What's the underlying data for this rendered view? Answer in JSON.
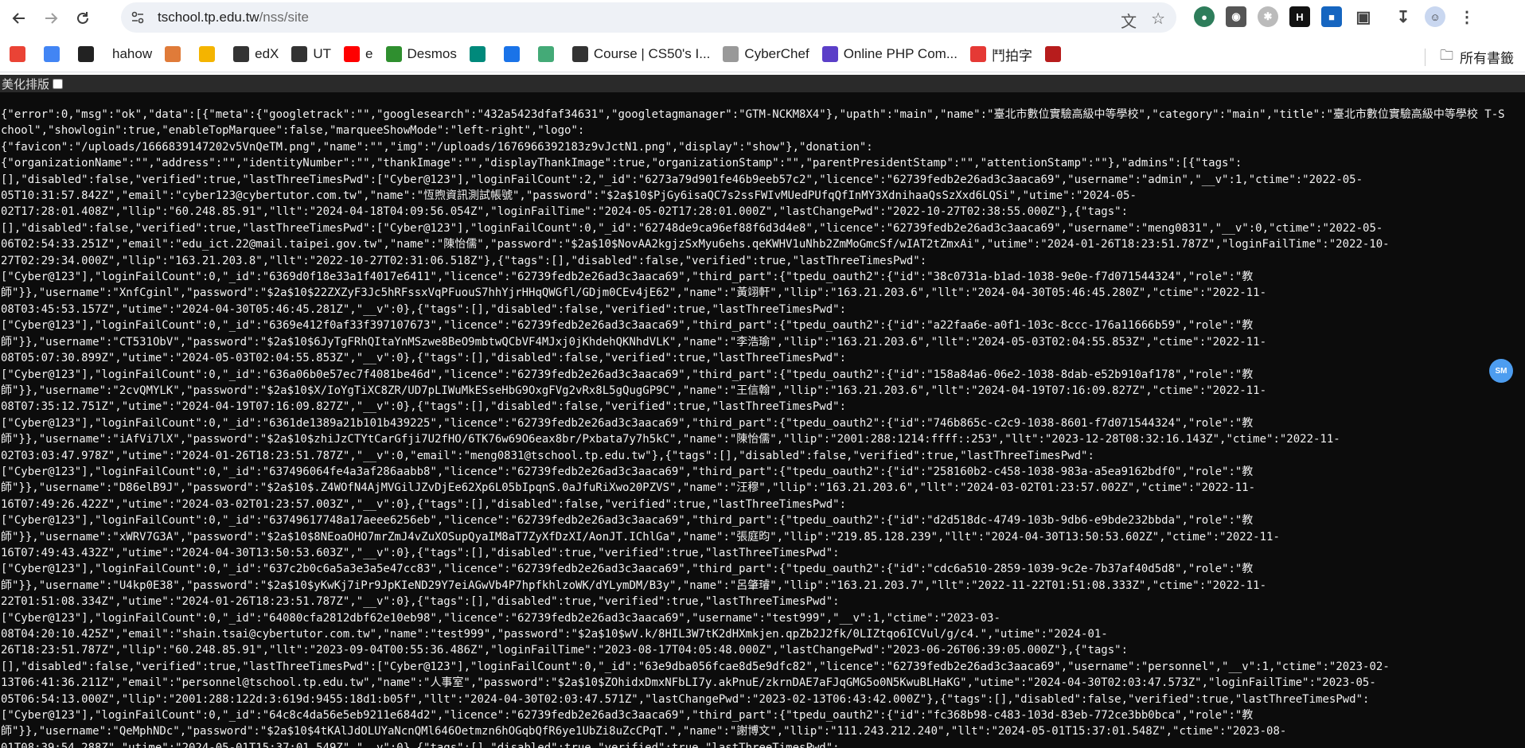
{
  "browser": {
    "url_host": "tschool.tp.edu.tw",
    "url_path": "/nss/site"
  },
  "bookmarks": [
    {
      "label": "",
      "icon": "gmail-icon",
      "color": "#ea4335"
    },
    {
      "label": "",
      "icon": "calendar-icon",
      "color": "#4285f4"
    },
    {
      "label": "",
      "icon": "infinity-icon",
      "color": "#222"
    },
    {
      "label": "hahow",
      "icon": "",
      "color": ""
    },
    {
      "label": "",
      "icon": "c-icon",
      "color": "#e07b39"
    },
    {
      "label": "",
      "icon": "photo-icon",
      "color": "#f4b400"
    },
    {
      "label": "edX",
      "icon": "edx-icon",
      "color": "#333"
    },
    {
      "label": "UT",
      "icon": "edx-icon",
      "color": "#333"
    },
    {
      "label": "e",
      "icon": "youtube-icon",
      "color": "#ff0000"
    },
    {
      "label": "Desmos",
      "icon": "desmos-icon",
      "color": "#2f8f2f"
    },
    {
      "label": "",
      "icon": "meet-icon",
      "color": "#00897b"
    },
    {
      "label": "",
      "icon": "drive-icon",
      "color": "#1a73e8"
    },
    {
      "label": "",
      "icon": "tree-icon",
      "color": "#4a7"
    },
    {
      "label": "Course | CS50's I...",
      "icon": "edx-icon",
      "color": "#333"
    },
    {
      "label": "CyberChef",
      "icon": "chef-icon",
      "color": "#999"
    },
    {
      "label": "Online PHP Com...",
      "icon": "php-icon",
      "color": "#5b3fc8"
    },
    {
      "label": "鬥拍字",
      "icon": "flame-icon",
      "color": "#e53935"
    },
    {
      "label": "",
      "icon": "red-square-icon",
      "color": "#b71c1c"
    }
  ],
  "all_bookmarks_label": "所有書籤",
  "pretty_print_label": "美化排版",
  "fab_label": "SM",
  "json_text": "{\"error\":0,\"msg\":\"ok\",\"data\":[{\"meta\":{\"googletrack\":\"\",\"googlesearch\":\"432a5423dfaf34631\",\"googletagmanager\":\"GTM-NCKM8X4\"},\"upath\":\"main\",\"name\":\"臺北市數位實驗高級中等學校\",\"category\":\"main\",\"title\":\"臺北市數位實驗高級中等學校 T-School\",\"showlogin\":true,\"enableTopMarquee\":false,\"marqueeShowMode\":\"left-right\",\"logo\":\n{\"favicon\":\"/uploads/1666839147202v5VnQeTM.png\",\"name\":\"\",\"img\":\"/uploads/1676966392183z9vJctN1.png\",\"display\":\"show\"},\"donation\":\n{\"organizationName\":\"\",\"address\":\"\",\"identityNumber\":\"\",\"thankImage\":\"\",\"displayThankImage\":true,\"organizationStamp\":\"\",\"parentPresidentStamp\":\"\",\"attentionStamp\":\"\"},\"admins\":[{\"tags\":\n[],\"disabled\":false,\"verified\":true,\"lastThreeTimesPwd\":[\"Cyber@123\"],\"loginFailCount\":2,\"_id\":\"6273a79d901fe46b9eeb57c2\",\"licence\":\"62739fedb2e26ad3c3aaca69\",\"username\":\"admin\",\"__v\":1,\"ctime\":\"2022-05-\n05T10:31:57.842Z\",\"email\":\"cyber123@cybertutor.com.tw\",\"name\":\"恆煦資訊測試帳號\",\"password\":\"$2a$10$PjGy6isaQC7s2ssFWIvMUedPUfqQfInMY3XdnihaaQsSzXxd6LQSi\",\"utime\":\"2024-05-\n02T17:28:01.408Z\",\"llip\":\"60.248.85.91\",\"llt\":\"2024-04-18T04:09:56.054Z\",\"loginFailTime\":\"2024-05-02T17:28:01.000Z\",\"lastChangePwd\":\"2022-10-27T02:38:55.000Z\"},{\"tags\":\n[],\"disabled\":false,\"verified\":true,\"lastThreeTimesPwd\":[\"Cyber@123\"],\"loginFailCount\":0,\"_id\":\"62748de9ca96ef88f6d3d4e8\",\"licence\":\"62739fedb2e26ad3c3aaca69\",\"username\":\"meng0831\",\"__v\":0,\"ctime\":\"2022-05-\n06T02:54:33.251Z\",\"email\":\"edu_ict.22@mail.taipei.gov.tw\",\"name\":\"陳怡儒\",\"password\":\"$2a$10$NovAA2kgjzSxMyu6ehs.qeKWHV1uNhb2ZmMoGmcSf/wIAT2tZmxAi\",\"utime\":\"2024-01-26T18:23:51.787Z\",\"loginFailTime\":\"2022-10-\n27T02:29:34.000Z\",\"llip\":\"163.21.203.8\",\"llt\":\"2022-10-27T02:31:06.518Z\"},{\"tags\":[],\"disabled\":false,\"verified\":true,\"lastThreeTimesPwd\":\n[\"Cyber@123\"],\"loginFailCount\":0,\"_id\":\"6369d0f18e33a1f4017e6411\",\"licence\":\"62739fedb2e26ad3c3aaca69\",\"third_part\":{\"tpedu_oauth2\":{\"id\":\"38c0731a-b1ad-1038-9e0e-f7d071544324\",\"role\":\"教\n師\"}},\"username\":\"XnfCginl\",\"password\":\"$2a$10$22ZXZyF3Jc5hRFssxVqPFuouS7hhYjrHHqQWGfl/GDjm0CEv4jE62\",\"name\":\"黃翊軒\",\"llip\":\"163.21.203.6\",\"llt\":\"2024-04-30T05:46:45.280Z\",\"ctime\":\"2022-11-\n08T03:45:53.157Z\",\"utime\":\"2024-04-30T05:46:45.281Z\",\"__v\":0},{\"tags\":[],\"disabled\":false,\"verified\":true,\"lastThreeTimesPwd\":\n[\"Cyber@123\"],\"loginFailCount\":0,\"_id\":\"6369e412f0af33f397107673\",\"licence\":\"62739fedb2e26ad3c3aaca69\",\"third_part\":{\"tpedu_oauth2\":{\"id\":\"a22faa6e-a0f1-103c-8ccc-176a11666b59\",\"role\":\"教\n師\"}},\"username\":\"CT531ObV\",\"password\":\"$2a$10$6JyTgFRhQItaYnMSzwe8BeO9mbtwQCbVF4MJxj0jKhdehQKNhdVLK\",\"name\":\"李浩瑜\",\"llip\":\"163.21.203.6\",\"llt\":\"2024-05-03T02:04:55.853Z\",\"ctime\":\"2022-11-\n08T05:07:30.899Z\",\"utime\":\"2024-05-03T02:04:55.853Z\",\"__v\":0},{\"tags\":[],\"disabled\":false,\"verified\":true,\"lastThreeTimesPwd\":\n[\"Cyber@123\"],\"loginFailCount\":0,\"_id\":\"636a06b0e57ec7f4081be46d\",\"licence\":\"62739fedb2e26ad3c3aaca69\",\"third_part\":{\"tpedu_oauth2\":{\"id\":\"158a84a6-06e2-1038-8dab-e52b910af178\",\"role\":\"教\n師\"}},\"username\":\"2cvQMYLK\",\"password\":\"$2a$10$X/IoYgTiXC8ZR/UD7pLIWuMkESseHbG9OxgFVg2vRx8L5gQugGP9C\",\"name\":\"王信翰\",\"llip\":\"163.21.203.6\",\"llt\":\"2024-04-19T07:16:09.827Z\",\"ctime\":\"2022-11-\n08T07:35:12.751Z\",\"utime\":\"2024-04-19T07:16:09.827Z\",\"__v\":0},{\"tags\":[],\"disabled\":false,\"verified\":true,\"lastThreeTimesPwd\":\n[\"Cyber@123\"],\"loginFailCount\":0,\"_id\":\"6361de1389a21b101b439225\",\"licence\":\"62739fedb2e26ad3c3aaca69\",\"third_part\":{\"tpedu_oauth2\":{\"id\":\"746b865c-c2c9-1038-8601-f7d071544324\",\"role\":\"教\n師\"}},\"username\":\"iAfVi7lX\",\"password\":\"$2a$10$zhiJzCTYtCarGfji7U2fHO/6TK76w69O6eax8br/Pxbata7y7h5kC\",\"name\":\"陳怡儒\",\"llip\":\"2001:288:1214:ffff::253\",\"llt\":\"2023-12-28T08:32:16.143Z\",\"ctime\":\"2022-11-\n02T03:03:47.978Z\",\"utime\":\"2024-01-26T18:23:51.787Z\",\"__v\":0,\"email\":\"meng0831@tschool.tp.edu.tw\"},{\"tags\":[],\"disabled\":false,\"verified\":true,\"lastThreeTimesPwd\":\n[\"Cyber@123\"],\"loginFailCount\":0,\"_id\":\"637496064fe4a3af286aabb8\",\"licence\":\"62739fedb2e26ad3c3aaca69\",\"third_part\":{\"tpedu_oauth2\":{\"id\":\"258160b2-c458-1038-983a-a5ea9162bdf0\",\"role\":\"教\n師\"}},\"username\":\"D86elB9J\",\"password\":\"$2a$10$.Z4WOfN4AjMVGilJZvDjEe62Xp6L05bIpqnS.0aJfuRiXwo20PZVS\",\"name\":\"汪穆\",\"llip\":\"163.21.203.6\",\"llt\":\"2024-03-02T01:23:57.002Z\",\"ctime\":\"2022-11-\n16T07:49:26.422Z\",\"utime\":\"2024-03-02T01:23:57.003Z\",\"__v\":0},{\"tags\":[],\"disabled\":false,\"verified\":true,\"lastThreeTimesPwd\":\n[\"Cyber@123\"],\"loginFailCount\":0,\"_id\":\"63749617748a17aeee6256eb\",\"licence\":\"62739fedb2e26ad3c3aaca69\",\"third_part\":{\"tpedu_oauth2\":{\"id\":\"d2d518dc-4749-103b-9db6-e9bde232bbda\",\"role\":\"教\n師\"}},\"username\":\"xWRV7G3A\",\"password\":\"$2a$10$8NEoaOHO7mrZmJ4vZuXOSupQyaIM8aT7ZyXfDzXI/AonJT.IChlGa\",\"name\":\"張庭昀\",\"llip\":\"219.85.128.239\",\"llt\":\"2024-04-30T13:50:53.602Z\",\"ctime\":\"2022-11-\n16T07:49:43.432Z\",\"utime\":\"2024-04-30T13:50:53.603Z\",\"__v\":0},{\"tags\":[],\"disabled\":true,\"verified\":true,\"lastThreeTimesPwd\":\n[\"Cyber@123\"],\"loginFailCount\":0,\"_id\":\"637c2b0c6a5a3e3a5e47cc83\",\"licence\":\"62739fedb2e26ad3c3aaca69\",\"third_part\":{\"tpedu_oauth2\":{\"id\":\"cdc6a510-2859-1039-9c2e-7b37af40d5d8\",\"role\":\"教\n師\"}},\"username\":\"U4kp0E38\",\"password\":\"$2a$10$yKwKj7iPr9JpKIeND29Y7eiAGwVb4P7hpfkhlzoWK/dYLymDM/B3y\",\"name\":\"呂肇璿\",\"llip\":\"163.21.203.7\",\"llt\":\"2022-11-22T01:51:08.333Z\",\"ctime\":\"2022-11-\n22T01:51:08.334Z\",\"utime\":\"2024-01-26T18:23:51.787Z\",\"__v\":0},{\"tags\":[],\"disabled\":true,\"verified\":true,\"lastThreeTimesPwd\":\n[\"Cyber@123\"],\"loginFailCount\":0,\"_id\":\"64080cfa2812dbf62e10eb98\",\"licence\":\"62739fedb2e26ad3c3aaca69\",\"username\":\"test999\",\"__v\":1,\"ctime\":\"2023-03-\n08T04:20:10.425Z\",\"email\":\"shain.tsai@cybertutor.com.tw\",\"name\":\"test999\",\"password\":\"$2a$10$wV.k/8HIL3W7tK2dHXmkjen.qpZb2J2fk/0LIZtqo6ICVul/g/c4.\",\"utime\":\"2024-01-\n26T18:23:51.787Z\",\"llip\":\"60.248.85.91\",\"llt\":\"2023-09-04T00:55:36.486Z\",\"loginFailTime\":\"2023-08-17T04:05:48.000Z\",\"lastChangePwd\":\"2023-06-26T06:39:05.000Z\"},{\"tags\":\n[],\"disabled\":false,\"verified\":true,\"lastThreeTimesPwd\":[\"Cyber@123\"],\"loginFailCount\":0,\"_id\":\"63e9dba056fcae8d5e9dfc82\",\"licence\":\"62739fedb2e26ad3c3aaca69\",\"username\":\"personnel\",\"__v\":1,\"ctime\":\"2023-02-\n13T06:41:36.211Z\",\"email\":\"personnel@tschool.tp.edu.tw\",\"name\":\"人事室\",\"password\":\"$2a$10$ZOhidxDmxNFbLI7y.akPnuE/zkrnDAE7aFJqGMG5o0N5KwuBLHaKG\",\"utime\":\"2024-04-30T02:03:47.573Z\",\"loginFailTime\":\"2023-05-\n05T06:54:13.000Z\",\"llip\":\"2001:288:122d:3:619d:9455:18d1:b05f\",\"llt\":\"2024-04-30T02:03:47.571Z\",\"lastChangePwd\":\"2023-02-13T06:43:42.000Z\"},{\"tags\":[],\"disabled\":false,\"verified\":true,\"lastThreeTimesPwd\":\n[\"Cyber@123\"],\"loginFailCount\":0,\"_id\":\"64c8c4da56e5eb9211e684d2\",\"licence\":\"62739fedb2e26ad3c3aaca69\",\"third_part\":{\"tpedu_oauth2\":{\"id\":\"fc368b98-c483-103d-83eb-772ce3bb0bca\",\"role\":\"教\n師\"}},\"username\":\"QeMphNDc\",\"password\":\"$2a$10$4tKAlJdOLUYaNcnQMl646Oetmzn6hOGqbQfR6ye1UbZi8uZcCPqT.\",\"name\":\"謝博文\",\"llip\":\"111.243.212.240\",\"llt\":\"2024-05-01T15:37:01.548Z\",\"ctime\":\"2023-08-\n01T08:39:54.288Z\",\"utime\":\"2024-05-01T15:37:01.549Z\",\"__v\":0},{\"tags\":[],\"disabled\":true,\"verified\":true,\"lastThreeTimesPwd\":"
}
